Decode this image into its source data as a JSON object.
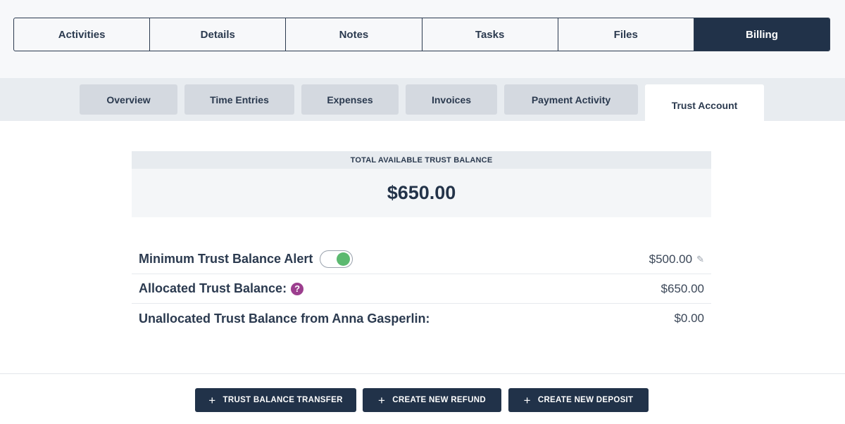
{
  "main_tabs": [
    {
      "label": "Activities",
      "active": false
    },
    {
      "label": "Details",
      "active": false
    },
    {
      "label": "Notes",
      "active": false
    },
    {
      "label": "Tasks",
      "active": false
    },
    {
      "label": "Files",
      "active": false
    },
    {
      "label": "Billing",
      "active": true
    }
  ],
  "sub_tabs": [
    {
      "label": "Overview",
      "active": false
    },
    {
      "label": "Time Entries",
      "active": false
    },
    {
      "label": "Expenses",
      "active": false
    },
    {
      "label": "Invoices",
      "active": false
    },
    {
      "label": "Payment Activity",
      "active": false
    },
    {
      "label": "Trust Account",
      "active": true
    }
  ],
  "balance": {
    "header": "TOTAL AVAILABLE TRUST BALANCE",
    "amount": "$650.00"
  },
  "rows": [
    {
      "label": "Minimum Trust Balance Alert",
      "value": "$500.00",
      "toggle_on": true,
      "icon": "pencil-icon"
    },
    {
      "label": "Allocated Trust Balance:",
      "value": "$650.00",
      "icon": "help-icon",
      "icon_glyph": "?"
    },
    {
      "label": "Unallocated Trust Balance from Anna Gasperlin:",
      "value": "$0.00"
    }
  ],
  "icons": {
    "edit": "✎",
    "plus": "+"
  },
  "buttons": [
    {
      "label": "TRUST BALANCE TRANSFER"
    },
    {
      "label": "CREATE NEW REFUND"
    },
    {
      "label": "CREATE NEW DEPOSIT"
    }
  ],
  "colors": {
    "primary": "#213249",
    "toggle_on": "#5cb970",
    "help_icon": "#9c3e8e"
  }
}
